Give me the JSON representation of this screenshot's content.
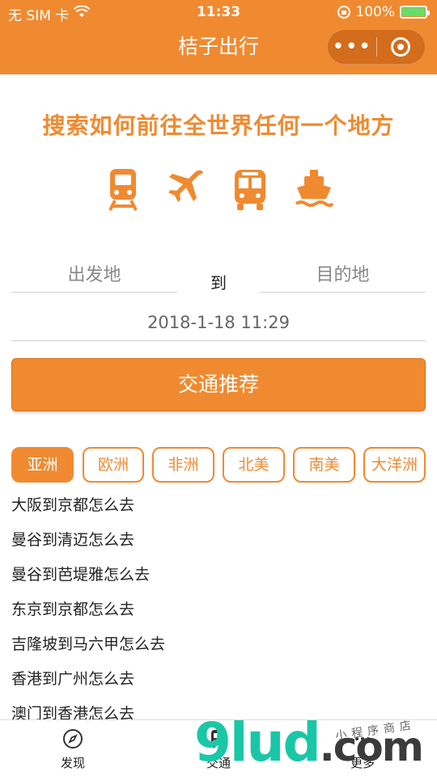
{
  "status_bar": {
    "carrier": "无 SIM 卡",
    "time": "11:33",
    "battery": "100%",
    "battery_level": 1.0
  },
  "nav": {
    "title": "桔子出行",
    "more_glyph": "•••"
  },
  "headline": "搜索如何前往全世界任何一个地方",
  "modes": [
    "train-icon",
    "airplane-icon",
    "bus-icon",
    "ship-icon"
  ],
  "search": {
    "origin_placeholder": "出发地",
    "to_label": "到",
    "destination_placeholder": "目的地",
    "datetime": "2018-1-18 11:29",
    "button_label": "交通推荐"
  },
  "continents": [
    {
      "label": "亚洲",
      "active": true
    },
    {
      "label": "欧洲",
      "active": false
    },
    {
      "label": "非洲",
      "active": false
    },
    {
      "label": "北美",
      "active": false
    },
    {
      "label": "南美",
      "active": false
    },
    {
      "label": "大洋洲",
      "active": false
    }
  ],
  "routes": [
    "大阪到京都怎么去",
    "曼谷到清迈怎么去",
    "曼谷到芭堤雅怎么去",
    "东京到京都怎么去",
    "吉隆坡到马六甲怎么去",
    "香港到广州怎么去",
    "澳门到香港怎么去"
  ],
  "tabbar": [
    {
      "label": "发现",
      "icon": "compass-icon"
    },
    {
      "label": "交通",
      "icon": "bus-icon"
    },
    {
      "label": "更多",
      "icon": "more-icon"
    }
  ],
  "watermark": {
    "logo": "9lud",
    "suffix": ".com",
    "handwritten": "小程序商店"
  },
  "colors": {
    "accent": "#f08a30",
    "watermark": "#19c7a6"
  }
}
